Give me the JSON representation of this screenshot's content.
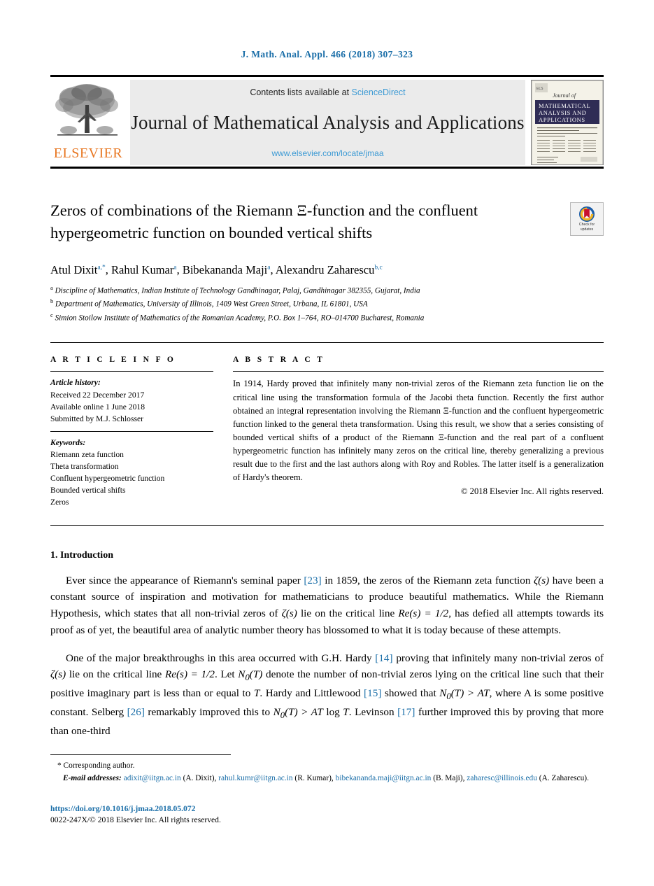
{
  "running_head": "J. Math. Anal. Appl. 466 (2018) 307–323",
  "masthead": {
    "publisher_name": "ELSEVIER",
    "contents_prefix": "Contents lists available at ",
    "sciencedirect": "ScienceDirect",
    "journal_name": "Journal of Mathematical Analysis and Applications",
    "journal_url": "www.elsevier.com/locate/jmaa",
    "cover": {
      "journal_of": "Journal of",
      "line1": "MATHEMATICAL",
      "line2": "ANALYSIS AND",
      "line3": "APPLICATIONS"
    }
  },
  "article": {
    "title": "Zeros of combinations of the Riemann Ξ-function and the confluent hypergeometric function on bounded vertical shifts",
    "crossmark": {
      "line1": "Check for",
      "line2": "updates"
    },
    "authors": [
      {
        "name": "Atul Dixit",
        "marks": "a,*"
      },
      {
        "name": "Rahul Kumar",
        "marks": "a"
      },
      {
        "name": "Bibekananda Maji",
        "marks": "a"
      },
      {
        "name": "Alexandru Zaharescu",
        "marks": "b,c"
      }
    ],
    "affiliations": [
      {
        "marker": "a",
        "text": "Discipline of Mathematics, Indian Institute of Technology Gandhinagar, Palaj, Gandhinagar 382355, Gujarat, India"
      },
      {
        "marker": "b",
        "text": "Department of Mathematics, University of Illinois, 1409 West Green Street, Urbana, IL 61801, USA"
      },
      {
        "marker": "c",
        "text": "Simion Stoilow Institute of Mathematics of the Romanian Academy, P.O. Box 1–764, RO–014700 Bucharest, Romania"
      }
    ]
  },
  "info": {
    "heading": "A R T I C L E   I N F O",
    "history_label": "Article history:",
    "history": [
      "Received 22 December 2017",
      "Available online 1 June 2018",
      "Submitted by M.J. Schlosser"
    ],
    "keywords_label": "Keywords:",
    "keywords": [
      "Riemann zeta function",
      "Theta transformation",
      "Confluent hypergeometric function",
      "Bounded vertical shifts",
      "Zeros"
    ]
  },
  "abstract": {
    "heading": "A B S T R A C T",
    "text": "In 1914, Hardy proved that infinitely many non-trivial zeros of the Riemann zeta function lie on the critical line using the transformation formula of the Jacobi theta function. Recently the first author obtained an integral representation involving the Riemann Ξ-function and the confluent hypergeometric function linked to the general theta transformation. Using this result, we show that a series consisting of bounded vertical shifts of a product of the Riemann Ξ-function and the real part of a confluent hypergeometric function has infinitely many zeros on the critical line, thereby generalizing a previous result due to the first and the last authors along with Roy and Robles. The latter itself is a generalization of Hardy's theorem.",
    "copyright": "© 2018 Elsevier Inc. All rights reserved."
  },
  "body": {
    "section_heading": "1. Introduction",
    "para1": {
      "a": "Ever since the appearance of Riemann's seminal paper ",
      "ref1": "[23]",
      "b": " in 1859, the zeros of the Riemann zeta function ",
      "m1": "ζ(s)",
      "c": " have been a constant source of inspiration and motivation for mathematicians to produce beautiful mathematics. While the Riemann Hypothesis, which states that all non-trivial zeros of ",
      "m2": "ζ(s)",
      "d": " lie on the critical line ",
      "m3": "Re(s) = 1/2",
      "e": ", has defied all attempts towards its proof as of yet, the beautiful area of analytic number theory has blossomed to what it is today because of these attempts."
    },
    "para2": {
      "a": "One of the major breakthroughs in this area occurred with G.H. Hardy ",
      "ref1": "[14]",
      "b": " proving that infinitely many non-trivial zeros of ",
      "m1": "ζ(s)",
      "c": " lie on the critical line ",
      "m2": "Re(s) = 1/2",
      "d": ". Let ",
      "m3": "N",
      "m3sub": "0",
      "m3b": "(T)",
      "e": " denote the number of non-trivial zeros lying on the critical line such that their positive imaginary part is less than or equal to ",
      "m4": "T",
      "f": ". Hardy and Littlewood ",
      "ref2": "[15]",
      "g": " showed that ",
      "m5": "N",
      "m5sub": "0",
      "m5b": "(T) > AT",
      "h": ", where A is some positive constant. Selberg ",
      "ref3": "[26]",
      "i": " remarkably improved this to ",
      "m6": "N",
      "m6sub": "0",
      "m6b": "(T) > AT",
      "m6c": " log ",
      "m6d": "T",
      "j": ". Levinson ",
      "ref4": "[17]",
      "k": " further improved this by proving that more than one-third"
    }
  },
  "footnotes": {
    "corresponding": "Corresponding author.",
    "email_label": "E-mail addresses:",
    "emails": [
      {
        "address": "adixit@iitgn.ac.in",
        "person": "(A. Dixit)",
        "sep": ", "
      },
      {
        "address": "rahul.kumr@iitgn.ac.in",
        "person": "(R. Kumar)",
        "sep": ", "
      },
      {
        "address": "bibekananda.maji@iitgn.ac.in",
        "person": "(B. Maji)",
        "sep": ", "
      },
      {
        "address": "zaharesc@illinois.edu",
        "person": "(A. Zaharescu).",
        "sep": ""
      }
    ]
  },
  "colophon": {
    "doi": "https://doi.org/10.1016/j.jmaa.2018.05.072",
    "issn": "0022-247X/© 2018 Elsevier Inc. All rights reserved."
  },
  "colors": {
    "link_blue": "#1a6ea8",
    "sciencedirect_blue": "#3c9ad4",
    "elsevier_orange": "#E87722",
    "cover_navy": "#2f2c55"
  }
}
